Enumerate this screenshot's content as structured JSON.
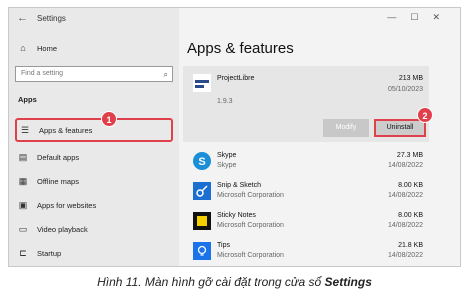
{
  "window": {
    "title": "Settings",
    "controls": [
      "—",
      "☐",
      "✕"
    ]
  },
  "sidebar": {
    "home_label": "Home",
    "search_placeholder": "Find a setting",
    "section_label": "Apps",
    "items": [
      {
        "label": "Apps & features",
        "icon": "apps-list-icon"
      },
      {
        "label": "Default apps",
        "icon": "default-apps-icon"
      },
      {
        "label": "Offline maps",
        "icon": "map-icon"
      },
      {
        "label": "Apps for websites",
        "icon": "website-icon"
      },
      {
        "label": "Video playback",
        "icon": "video-icon"
      },
      {
        "label": "Startup",
        "icon": "startup-icon"
      }
    ]
  },
  "main": {
    "title": "Apps & features",
    "selected_app": {
      "name": "ProjectLibre",
      "version": "1.9.3",
      "size": "213 MB",
      "date": "05/10/2023",
      "modify_label": "Modify",
      "uninstall_label": "Uninstall"
    },
    "apps": [
      {
        "name": "Skype",
        "publisher": "Skype",
        "size": "27.3 MB",
        "date": "14/08/2022",
        "color": "#1a8fd8"
      },
      {
        "name": "Snip & Sketch",
        "publisher": "Microsoft Corporation",
        "size": "8.00 KB",
        "date": "14/08/2022",
        "color": "#1a6fd0"
      },
      {
        "name": "Sticky Notes",
        "publisher": "Microsoft Corporation",
        "size": "8.00 KB",
        "date": "14/08/2022",
        "color": "#111111"
      },
      {
        "name": "Tips",
        "publisher": "Microsoft Corporation",
        "size": "21.8 KB",
        "date": "14/08/2022",
        "color": "#1a73e8"
      }
    ]
  },
  "callouts": [
    "1",
    "2"
  ],
  "caption": {
    "prefix": "Hình 11. Màn hình gỡ cài đặt trong cửa sổ ",
    "bold": "Settings"
  }
}
